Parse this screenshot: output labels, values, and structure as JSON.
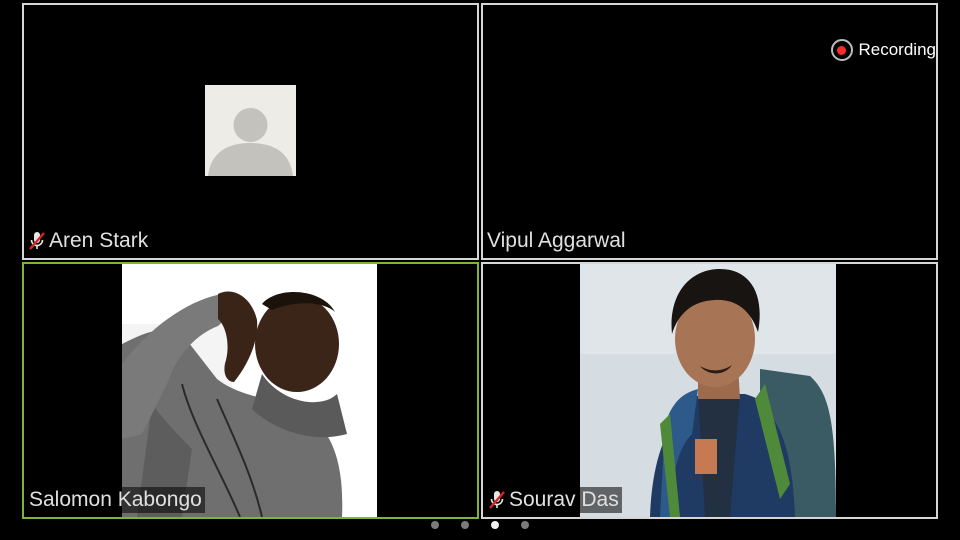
{
  "recording": {
    "label": "Recording",
    "color": "#ff2a2a"
  },
  "participants": [
    {
      "name": "Aren Stark",
      "muted": true,
      "video": false,
      "avatar_icon": "person-placeholder-icon"
    },
    {
      "name": "Vipul Aggarwal",
      "muted": false,
      "video": false
    },
    {
      "name": "Salomon Kabongo",
      "muted": false,
      "video": true,
      "active_speaker": true
    },
    {
      "name": "Sourav Das",
      "muted": true,
      "video": true
    }
  ],
  "pager": {
    "page_count": 4,
    "current_page": 3
  },
  "colors": {
    "active_speaker_border": "#7fb43a",
    "tile_border": "#d6d6d6",
    "muted_icon": "#d9261c"
  }
}
